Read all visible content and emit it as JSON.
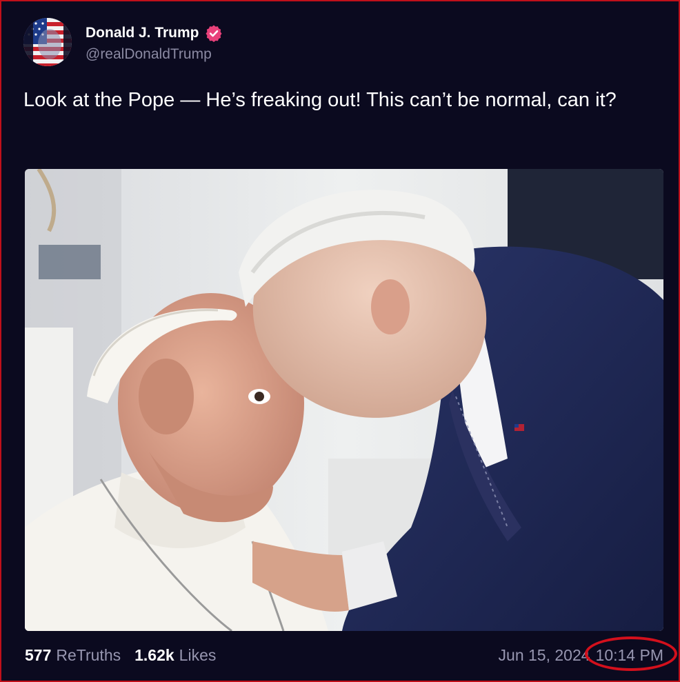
{
  "post": {
    "display_name": "Donald J. Trump",
    "handle": "@realDonaldTrump",
    "text": "Look at the Pope — He’s freaking out! This can’t be normal, can it?",
    "verified_icon": "verified-badge-icon",
    "media_description_icon": "photo"
  },
  "stats": {
    "retruths_count": "577",
    "retruths_label": "ReTruths",
    "likes_count": "1.62k",
    "likes_label": "Likes"
  },
  "timestamp": {
    "date": "Jun 15, 2024",
    "time": "10:14 PM"
  },
  "colors": {
    "background": "#0b0a1f",
    "text_primary": "#ffffff",
    "text_secondary": "#9796b0",
    "verified_badge": "#e8417a",
    "annotation_red": "#d3101c"
  }
}
